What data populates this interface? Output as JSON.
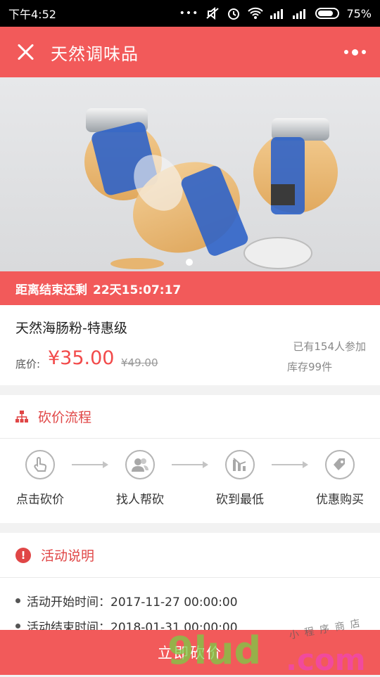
{
  "status_bar": {
    "time": "下午4:52",
    "battery": "75%"
  },
  "header": {
    "title": "天然调味品"
  },
  "countdown": {
    "label": "距离结束还剩",
    "value": "22天15:07:17"
  },
  "product": {
    "name": "天然海肠粉-特惠级",
    "price_label": "底价:",
    "price_current": "¥35.00",
    "price_original": "¥49.00",
    "participants": "已有154人参加",
    "stock": "库存99件"
  },
  "process": {
    "title": "砍价流程",
    "steps": [
      {
        "label": "点击砍价",
        "icon": "tap-hand-icon"
      },
      {
        "label": "找人帮砍",
        "icon": "people-icon"
      },
      {
        "label": "砍到最低",
        "icon": "chart-down-icon"
      },
      {
        "label": "优惠购买",
        "icon": "tag-icon"
      }
    ]
  },
  "activity": {
    "title": "活动说明",
    "items": [
      "活动开始时间：2017-11-27 00:00:00",
      "活动结束时间：2018-01-31 00:00:00"
    ]
  },
  "bottom": {
    "button_label": "立即砍价"
  },
  "watermark": {
    "text_main": "9lud",
    "text_domain": ".com",
    "text_cn": "小程序商店"
  },
  "colors": {
    "accent": "#f25a5a",
    "price": "#f24a4a"
  }
}
